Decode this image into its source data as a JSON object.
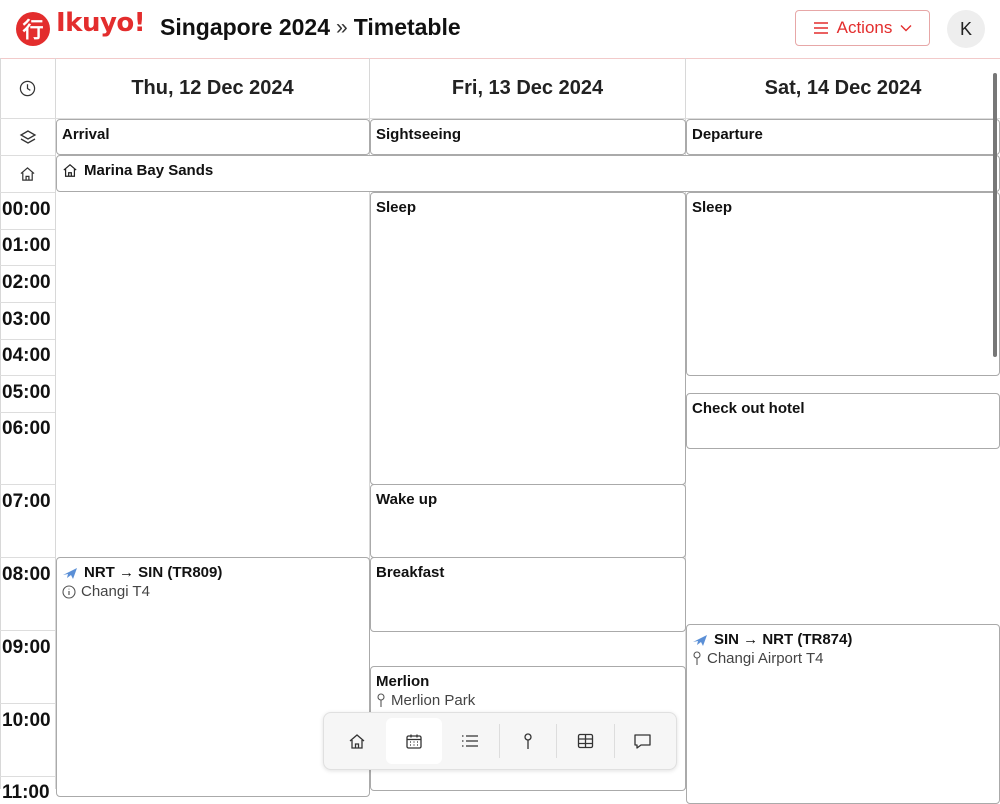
{
  "app": {
    "logo_glyph": "行",
    "logo_text": "Ikuyo!",
    "brand_color": "#e32d2d"
  },
  "breadcrumb": {
    "trip": "Singapore 2024",
    "separator": "»",
    "page": "Timetable"
  },
  "header": {
    "actions_label": "Actions",
    "avatar_initial": "K"
  },
  "days": [
    {
      "label": "Thu, 12 Dec 2024",
      "day_title": "Arrival"
    },
    {
      "label": "Fri, 13 Dec 2024",
      "day_title": "Sightseeing"
    },
    {
      "label": "Sat, 14 Dec 2024",
      "day_title": "Departure"
    }
  ],
  "accommodation": {
    "name": "Marina Bay Sands",
    "icon": "home-icon"
  },
  "hours": [
    "00:00",
    "01:00",
    "02:00",
    "03:00",
    "04:00",
    "05:00",
    "06:00",
    "07:00",
    "08:00",
    "09:00",
    "10:00",
    "11:00"
  ],
  "activities": {
    "thu_flight": {
      "title": "NRT → SIN (TR809)",
      "icon": "plane-icon",
      "note": "Changi T4",
      "note_icon": "info-icon"
    },
    "fri_sleep": {
      "title": "Sleep"
    },
    "fri_wakeup": {
      "title": "Wake up"
    },
    "fri_breakfast": {
      "title": "Breakfast"
    },
    "fri_merlion": {
      "title": "Merlion",
      "location": "Merlion Park",
      "location_icon": "pin-icon"
    },
    "sat_sleep": {
      "title": "Sleep"
    },
    "sat_checkout": {
      "title": "Check out hotel"
    },
    "sat_flight": {
      "title": "SIN → NRT (TR874)",
      "icon": "plane-icon",
      "location": "Changi Airport T4",
      "location_icon": "pin-icon"
    }
  },
  "bottom_nav": [
    {
      "name": "home",
      "icon": "home-icon",
      "active": false
    },
    {
      "name": "timetable",
      "icon": "calendar-icon",
      "active": true
    },
    {
      "name": "list",
      "icon": "list-icon",
      "active": false
    },
    {
      "name": "map",
      "icon": "pin-icon",
      "active": false
    },
    {
      "name": "expenses",
      "icon": "table-icon",
      "active": false
    },
    {
      "name": "comments",
      "icon": "comment-icon",
      "active": false
    }
  ]
}
